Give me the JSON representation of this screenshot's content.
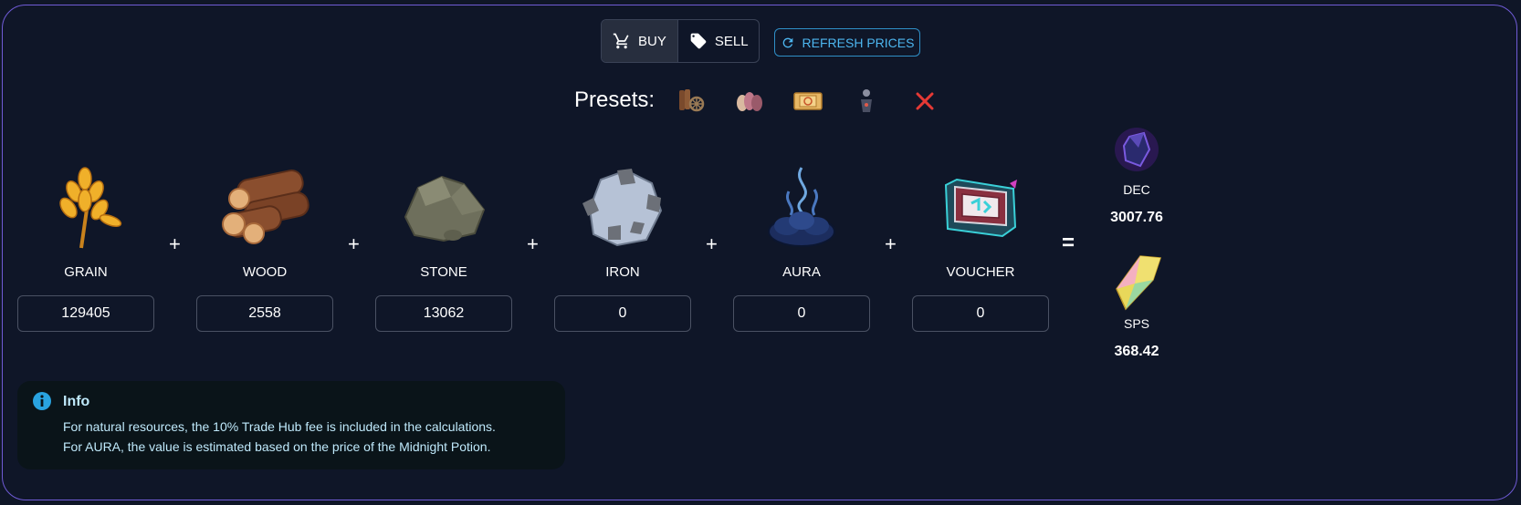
{
  "toolbar": {
    "buy_label": "BUY",
    "sell_label": "SELL",
    "refresh_label": "REFRESH PRICES",
    "buy_icon": "cart-icon",
    "sell_icon": "tag-icon",
    "refresh_icon": "refresh-icon"
  },
  "presets": {
    "label": "Presets:",
    "items": [
      "wood-and-wheel-preset-icon",
      "seeds-preset-icon",
      "voucher-ticket-preset-icon",
      "figure-preset-icon",
      "clear-x-icon"
    ]
  },
  "resources": [
    {
      "label": "GRAIN",
      "value": "129405",
      "icon": "grain-icon"
    },
    {
      "label": "WOOD",
      "value": "2558",
      "icon": "wood-icon"
    },
    {
      "label": "STONE",
      "value": "13062",
      "icon": "stone-icon"
    },
    {
      "label": "IRON",
      "value": "0",
      "icon": "iron-icon"
    },
    {
      "label": "AURA",
      "value": "0",
      "icon": "aura-icon"
    },
    {
      "label": "VOUCHER",
      "value": "0",
      "icon": "voucher-icon"
    }
  ],
  "operators": {
    "plus": "+",
    "equals": "="
  },
  "outputs": [
    {
      "label": "DEC",
      "value": "3007.76",
      "icon": "dec-crystal-icon"
    },
    {
      "label": "SPS",
      "value": "368.42",
      "icon": "sps-crystal-icon"
    }
  ],
  "info": {
    "title": "Info",
    "lines": [
      "For natural resources, the 10% Trade Hub fee is included in the calculations.",
      "For AURA, the value is estimated based on the price of the Midnight Potion."
    ]
  },
  "colors": {
    "background": "#0f1627",
    "border": "#6f5bd6",
    "accent": "#4db6f0",
    "info_text": "#bfe9fb",
    "clear_red": "#e53935"
  }
}
